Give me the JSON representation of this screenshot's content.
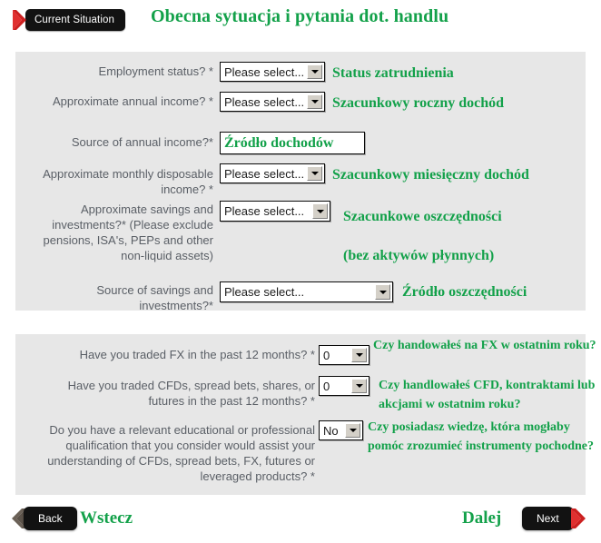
{
  "header": {
    "badge_label": "Current Situation",
    "title_pl": "Obecna sytuacja i pytania dot. handlu",
    "chevron_icon": "red-chevron-right-icon"
  },
  "colors": {
    "accent_green": "#13A14A",
    "panel_bg": "#e7e7e7",
    "label_text": "#5a5f66",
    "pill_black": "#121212",
    "arrow_red": "#cc2020",
    "arrow_gray": "#6b6157"
  },
  "placeholders": {
    "please_select": "Please select..."
  },
  "situation": {
    "rows": [
      {
        "label": "Employment status? *",
        "field_kind": "select",
        "value": "Please select...",
        "annotation": "Status zatrudnienia"
      },
      {
        "label": "Approximate annual income? *",
        "field_kind": "select",
        "value": "Please select...",
        "annotation": "Szacunkowy roczny dochód"
      },
      {
        "label": "Source of annual income?*",
        "field_kind": "textbox",
        "value": "Źródło dochodów",
        "annotation": ""
      },
      {
        "label": "Approximate monthly disposable income? *",
        "field_kind": "select",
        "value": "Please select...",
        "annotation": "Szacunkowy miesięczny dochód"
      },
      {
        "label": "Approximate savings and investments?* (Please exclude pensions, ISA's, PEPs and other non-liquid assets)",
        "field_kind": "select",
        "value": "Please select...",
        "annotation": "Szacunkowe oszczędności",
        "annotation_line2": "(bez aktywów płynnych)"
      },
      {
        "label": "Source of savings and investments?*",
        "field_kind": "select-wide",
        "value": "Please select...",
        "annotation": "Źródło oszczędności"
      }
    ]
  },
  "trading": {
    "rows": [
      {
        "label": "Have you traded FX in the past 12 months? *",
        "value": "0",
        "annotation": "Czy handowałeś na FX w ostatnim roku?"
      },
      {
        "label": "Have you traded CFDs, spread bets, shares, or futures in the past 12 months? *",
        "value": "0",
        "annotation": "Czy handlowałeś CFD, kontraktami lub akcjami w ostatnim roku?"
      },
      {
        "label": "Do you have a relevant educational or professional qualification that you consider would assist your understanding of CFDs, spread bets, FX, futures or leveraged products? *",
        "value": "No",
        "annotation": "Czy posiadasz wiedzę, która mogłaby pomóc zrozumieć instrumenty pochodne?"
      }
    ]
  },
  "footer": {
    "back_label": "Back",
    "back_label_pl": "Wstecz",
    "next_label": "Next",
    "next_label_pl": "Dalej",
    "back_icon": "gray-chevron-left-icon",
    "next_icon": "red-chevron-right-icon"
  }
}
